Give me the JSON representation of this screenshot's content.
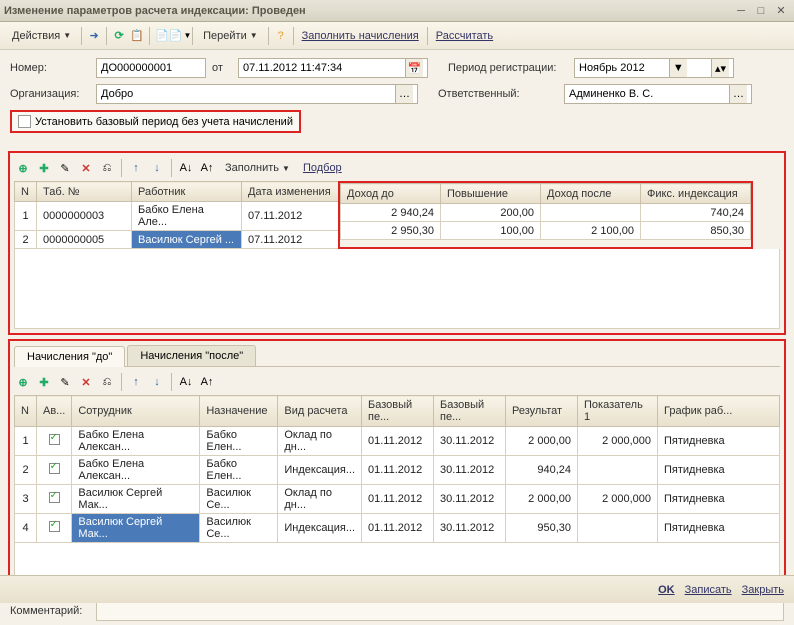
{
  "title": "Изменение параметров расчета индексации: Проведен",
  "toolbar": {
    "actions": "Действия",
    "goto": "Перейти",
    "fill": "Заполнить начисления",
    "calc": "Рассчитать"
  },
  "form": {
    "number_lbl": "Номер:",
    "number": "ДО000000001",
    "from_lbl": "от",
    "date": "07.11.2012 11:47:34",
    "period_lbl": "Период регистрации:",
    "period": "Ноябрь 2012",
    "org_lbl": "Организация:",
    "org": "Добро",
    "resp_lbl": "Ответственный:",
    "resp": "Админенко В. С.",
    "base_chk": "Установить базовый период без учета начислений"
  },
  "mini": {
    "fill": "Заполнить",
    "select": "Подбор"
  },
  "top_table": {
    "headers": [
      "N",
      "Таб. №",
      "Работник",
      "Дата изменения",
      "Доход до",
      "Повышение",
      "Доход после",
      "Фикс. индексация"
    ],
    "rows": [
      {
        "n": "1",
        "tab": "0000000003",
        "emp": "Бабко Елена Але...",
        "date": "07.11.2012",
        "d1": "2 940,24",
        "pov": "200,00",
        "d2": "",
        "fix": "740,24"
      },
      {
        "n": "2",
        "tab": "0000000005",
        "emp": "Василюк Сергей ...",
        "date": "07.11.2012",
        "d1": "2 950,30",
        "pov": "100,00",
        "d2": "2 100,00",
        "fix": "850,30"
      }
    ]
  },
  "tabs": {
    "before": "Начисления \"до\"",
    "after": "Начисления \"после\""
  },
  "bot_table": {
    "headers": [
      "N",
      "Ав...",
      "Сотрудник",
      "Назначение",
      "Вид расчета",
      "Базовый пе...",
      "Базовый пе...",
      "Результат",
      "Показатель 1",
      "График раб..."
    ],
    "rows": [
      {
        "n": "1",
        "emp": "Бабко Елена Алексан...",
        "ass": "Бабко Елен...",
        "type": "Оклад по дн...",
        "b1": "01.11.2012",
        "b2": "30.11.2012",
        "res": "2 000,00",
        "p1": "2 000,000",
        "g": "Пятидневка"
      },
      {
        "n": "2",
        "emp": "Бабко Елена Алексан...",
        "ass": "Бабко Елен...",
        "type": "Индексация...",
        "b1": "01.11.2012",
        "b2": "30.11.2012",
        "res": "940,24",
        "p1": "",
        "g": "Пятидневка"
      },
      {
        "n": "3",
        "emp": "Василюк Сергей Мак...",
        "ass": "Василюк Се...",
        "type": "Оклад по дн...",
        "b1": "01.11.2012",
        "b2": "30.11.2012",
        "res": "2 000,00",
        "p1": "2 000,000",
        "g": "Пятидневка"
      },
      {
        "n": "4",
        "emp": "Василюк Сергей Мак...",
        "ass": "Василюк Се...",
        "type": "Индексация...",
        "b1": "01.11.2012",
        "b2": "30.11.2012",
        "res": "950,30",
        "p1": "",
        "g": "Пятидневка"
      }
    ]
  },
  "comment_lbl": "Комментарий:",
  "footer": {
    "ok": "OK",
    "save": "Записать",
    "close": "Закрыть"
  }
}
